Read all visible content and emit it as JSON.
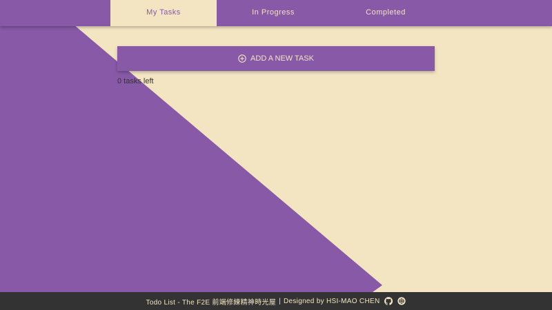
{
  "colors": {
    "primary": "#8759a7",
    "background": "#f3e5c2",
    "footer": "#333333"
  },
  "tabs": [
    {
      "label": "My Tasks",
      "active": true
    },
    {
      "label": "In Progress",
      "active": false
    },
    {
      "label": "Completed",
      "active": false
    }
  ],
  "add_task": {
    "icon": "plus-circle-icon",
    "label": "ADD A NEW TASK"
  },
  "status": {
    "tasks_left": "0 tasks left"
  },
  "footer": {
    "title": "Todo List - The F2E 前端修練精神時光屋",
    "separator": "|",
    "credit": "Designed by HSI-MAO CHEN",
    "icons": [
      "github-icon",
      "codepen-icon"
    ]
  }
}
